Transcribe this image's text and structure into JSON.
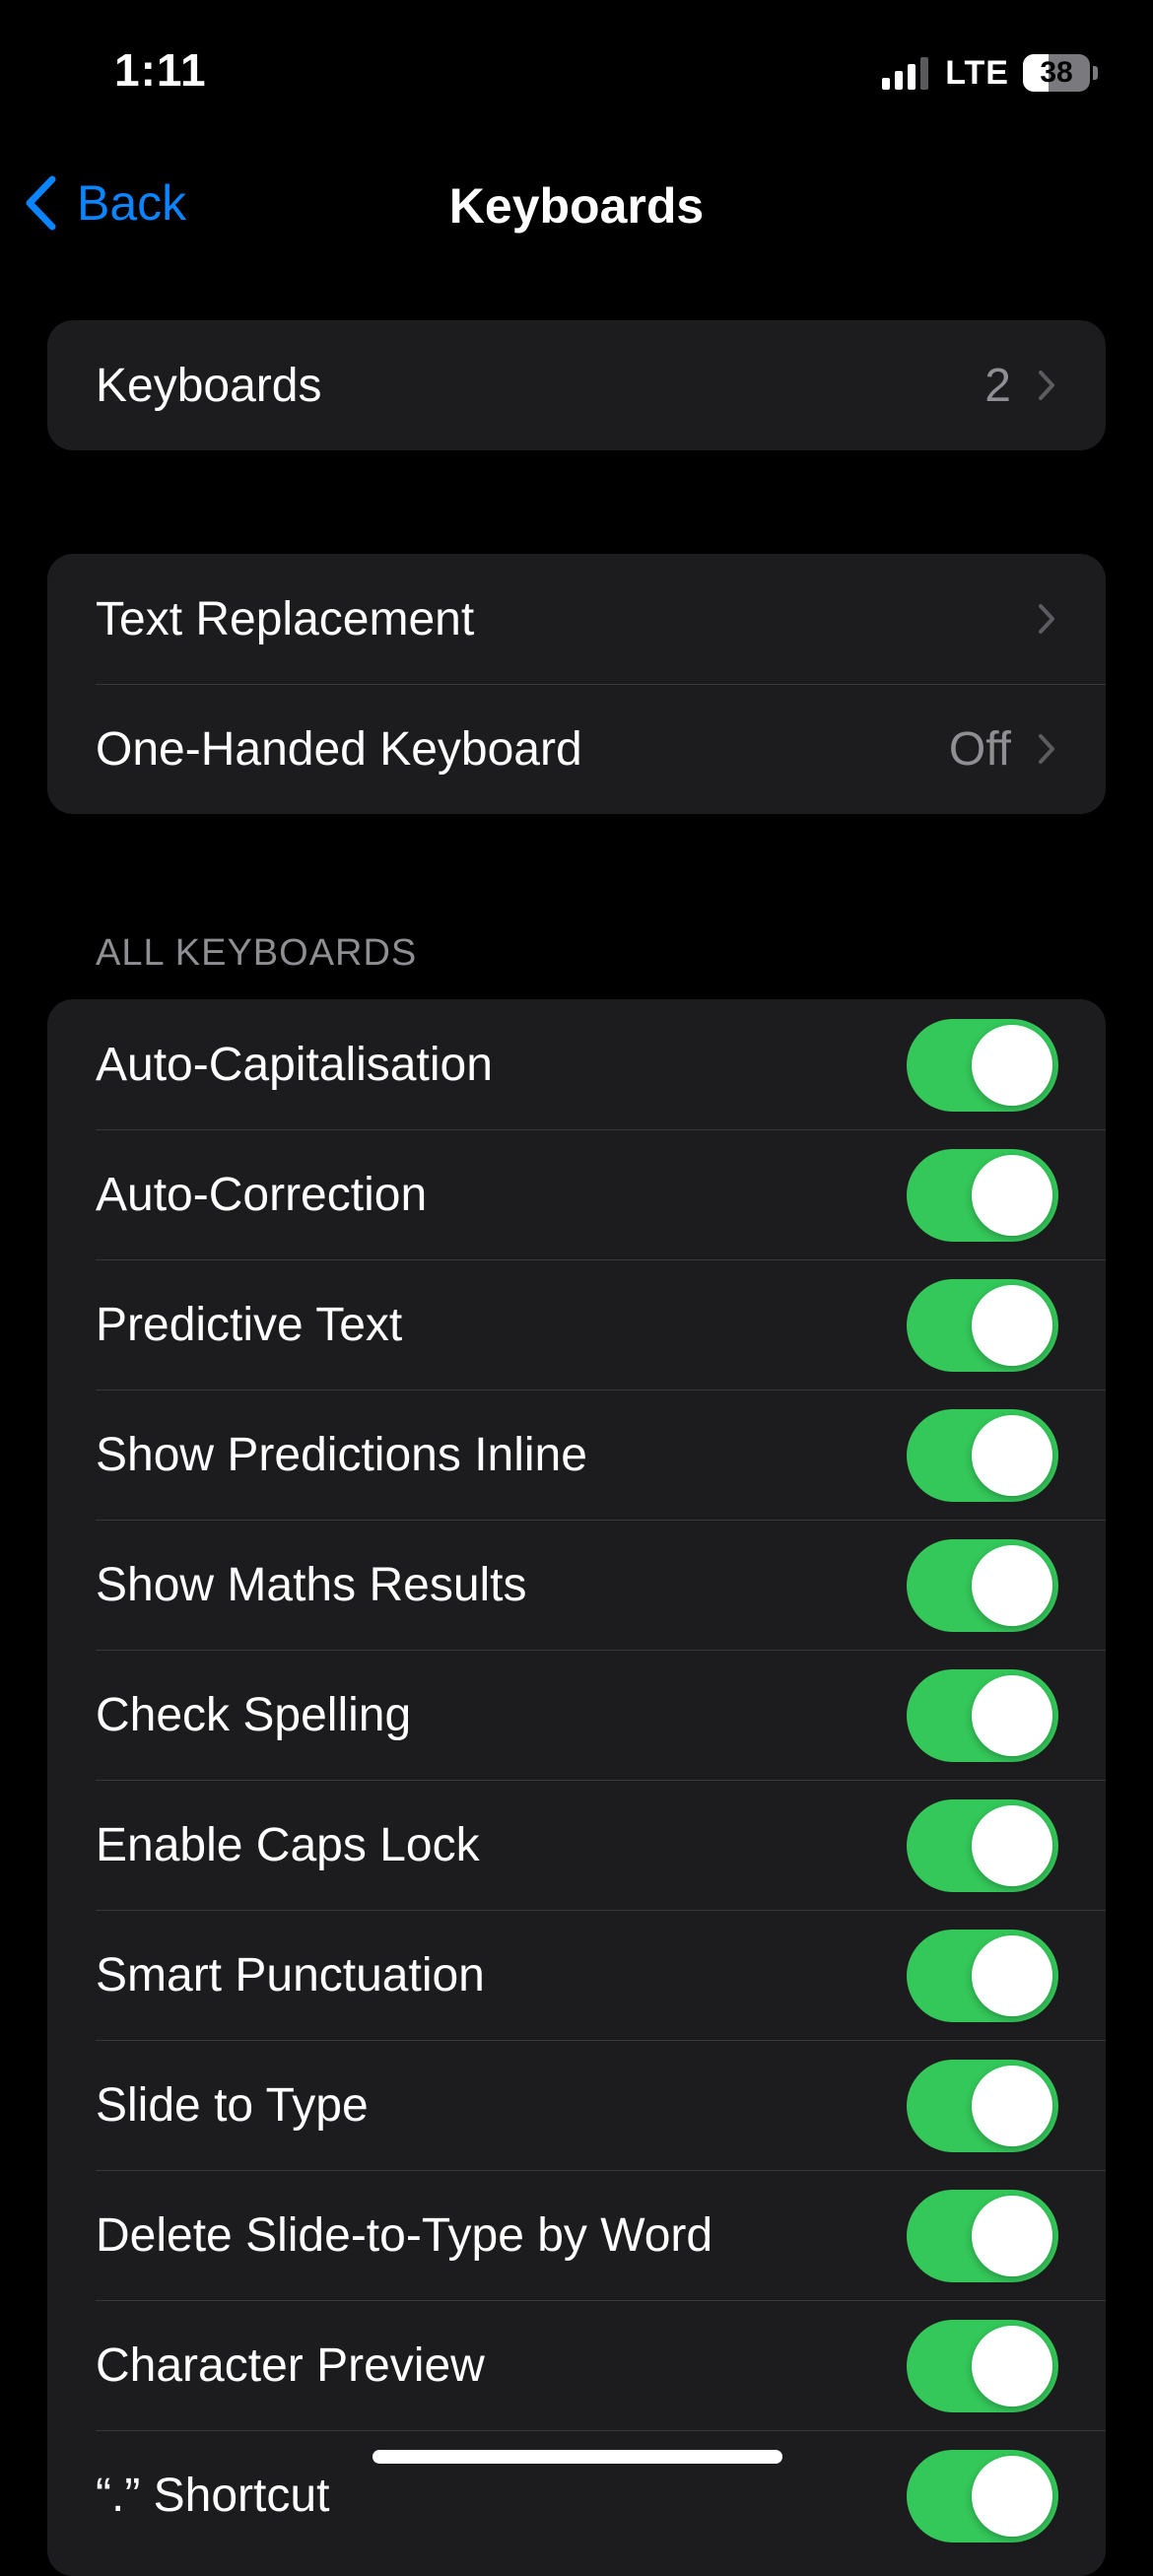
{
  "status_bar": {
    "time": "1:11",
    "network": "LTE",
    "battery": "38",
    "battery_level_percent": 38,
    "signal_bars_active": 3,
    "signal_bars_total": 4
  },
  "nav": {
    "back_label": "Back",
    "title": "Keyboards"
  },
  "group1": {
    "keyboards_label": "Keyboards",
    "keyboards_value": "2"
  },
  "group2": {
    "text_replacement_label": "Text Replacement",
    "one_handed_label": "One-Handed Keyboard",
    "one_handed_value": "Off"
  },
  "all_keyboards": {
    "header": "ALL KEYBOARDS",
    "items": [
      {
        "label": "Auto-Capitalisation",
        "on": true
      },
      {
        "label": "Auto-Correction",
        "on": true
      },
      {
        "label": "Predictive Text",
        "on": true
      },
      {
        "label": "Show Predictions Inline",
        "on": true
      },
      {
        "label": "Show Maths Results",
        "on": true
      },
      {
        "label": "Check Spelling",
        "on": true
      },
      {
        "label": "Enable Caps Lock",
        "on": true
      },
      {
        "label": "Smart Punctuation",
        "on": true
      },
      {
        "label": "Slide to Type",
        "on": true
      },
      {
        "label": "Delete Slide-to-Type by Word",
        "on": true
      },
      {
        "label": "Character Preview",
        "on": true
      },
      {
        "label": "“.” Shortcut",
        "on": true
      }
    ]
  },
  "colors": {
    "background": "#000000",
    "cell": "#1c1c1e",
    "accent": "#0a84ff",
    "toggle_on": "#34c759",
    "secondary_text": "#8e8e93"
  }
}
